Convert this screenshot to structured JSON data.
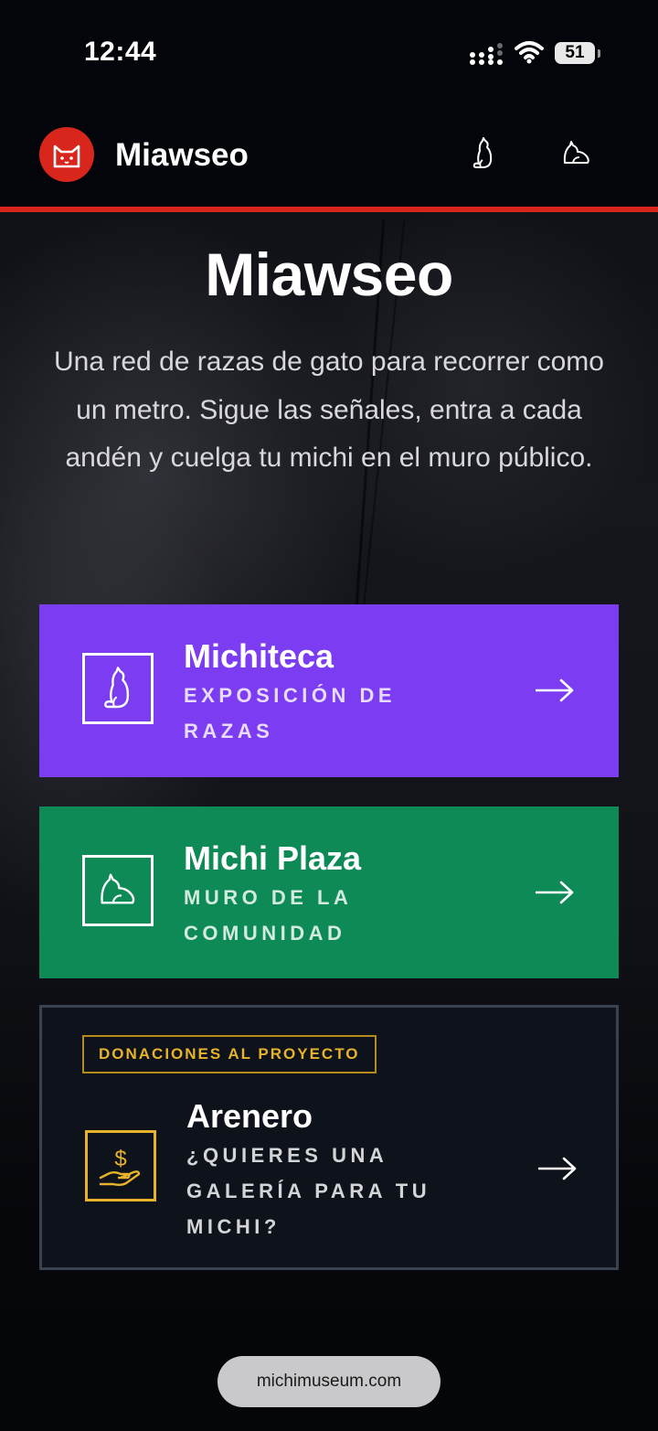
{
  "status_bar": {
    "time": "12:44",
    "battery": "51"
  },
  "header": {
    "brand": "Miawseo"
  },
  "hero": {
    "title": "Miawseo",
    "description": "Una red de razas de gato para recorrer como un metro. Sigue las señales, entra a cada andén y cuelga tu michi en el muro público."
  },
  "cards": [
    {
      "title": "Michiteca",
      "subtitle": "EXPOSICIÓN DE RAZAS",
      "color": "#7b3cf2",
      "icon": "cat-sitting-icon"
    },
    {
      "title": "Michi Plaza",
      "subtitle": "MURO DE LA COMUNIDAD",
      "color": "#0d8a56",
      "icon": "cat-lying-icon"
    },
    {
      "badge": "DONACIONES AL PROYECTO",
      "title": "Arenero",
      "subtitle": "¿QUIERES UNA GALERÍA PARA TU MICHI?",
      "color": "#0e131b",
      "accent": "#e7b32a",
      "icon": "donation-hand-icon"
    }
  ],
  "browser": {
    "url": "michimuseum.com"
  }
}
